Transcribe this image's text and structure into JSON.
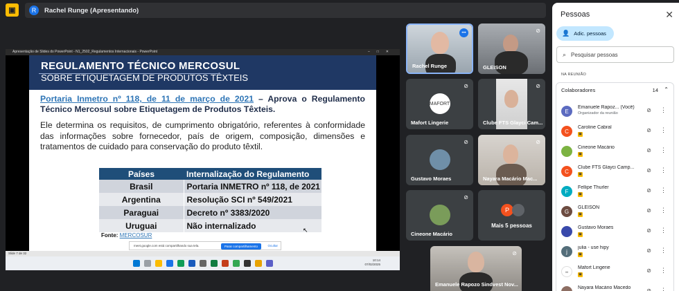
{
  "meet": {
    "logo_icon": "present-icon",
    "presenter": {
      "avatar_letter": "R",
      "label": "Rachel Runge (Apresentando)"
    }
  },
  "share": {
    "window_title": "Apresentação de Slides do PowerPoint  -  N1_2502_Regulamentos Internacionais  -  PowerPoint",
    "slide": {
      "title1": "REGULAMENTO TÉCNICO MERCOSUL",
      "title2": "SOBRE ETIQUETAGEM DE PRODUTOS TÊXTEIS",
      "p1_link": "Portaria Inmetro nº 118, de 11 de março de 2021",
      "p1_rest": " – Aprova o Regulamento Técnico Mercosul sobre Etiquetagem de Produtos Têxteis.",
      "p2": "Ele determina os requisitos, de cumprimento obrigatório, referentes à conformidade das informações sobre fornecedor, país de origem, composição, dimensões e tratamentos de cuidado para conservação do produto têxtil.",
      "table_headers": [
        "Países",
        "Internalização do Regulamento"
      ],
      "table_rows": [
        [
          "Brasil",
          "Portaria INMETRO nº 118, de 2021"
        ],
        [
          "Argentina",
          "Resolução SCI nº 549/2021"
        ],
        [
          "Paraguai",
          "Decreto nº 3383/2020"
        ],
        [
          "Uruguai",
          "Não internalizado"
        ]
      ],
      "fonte_label": "Fonte: ",
      "fonte_link": "MERCOSUR"
    },
    "notice": {
      "text": "meet.google.com está compartilhando sua tela.",
      "stop": "Parar compartilhamento",
      "hide": "Ocultar"
    },
    "status": "Slide 7 de 32",
    "clock": {
      "time": "10:14",
      "date": "07/02/2025"
    }
  },
  "tiles": [
    {
      "name": "Rachel Runge",
      "muted": false
    },
    {
      "name": "GLEISON",
      "muted": true
    },
    {
      "name": "Mafort Lingerie",
      "muted": true,
      "logo": "MAFORT"
    },
    {
      "name": "Clube FTS Glayci Cam...",
      "muted": true
    },
    {
      "name": "Gustavo Moraes",
      "muted": true
    },
    {
      "name": "Nayara Macário Mac...",
      "muted": true
    },
    {
      "name": "Cineone Macário",
      "muted": true
    },
    {
      "more_label": "Mais 5 pessoas",
      "more_letter": "P"
    },
    {
      "name": "Emanuele Rapozo Sindvest Nov..."
    }
  ],
  "people": {
    "title": "Pessoas",
    "add_label": "Adic. pessoas",
    "search_placeholder": "Pesquisar pessoas",
    "section": "NA REUNIÃO",
    "group_label": "Colaboradores",
    "group_count": "14",
    "list": [
      {
        "letter": "E",
        "color": "#5c6bc0",
        "name": "Emanuele Rapoz...  (Você)",
        "sub": "Organizador da reunião"
      },
      {
        "letter": "C",
        "color": "#f4511e",
        "name": "Caroline Cabral"
      },
      {
        "letter": "",
        "color": "#7cb342",
        "name": "Cineone Macário"
      },
      {
        "letter": "C",
        "color": "#f4511e",
        "name": "Clube FTS Glayci Camp..."
      },
      {
        "letter": "F",
        "color": "#00acc1",
        "name": "Fellipe Thurler"
      },
      {
        "letter": "G",
        "color": "#6d4c41",
        "name": "GLEISON"
      },
      {
        "letter": "",
        "color": "#3949ab",
        "name": "Gustavo Moraes"
      },
      {
        "letter": "j",
        "color": "#546e7a",
        "name": "julia - use hipy"
      },
      {
        "letter": "M",
        "color": "#ffffff",
        "name": "Mafort Lingerie"
      },
      {
        "letter": "",
        "color": "#8d6e63",
        "name": "Nayara Macário Macedo"
      }
    ]
  }
}
